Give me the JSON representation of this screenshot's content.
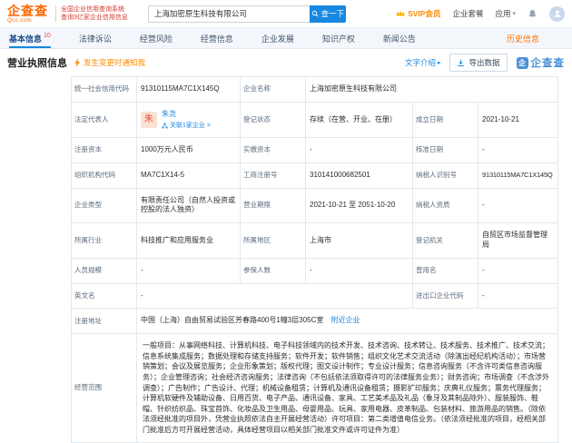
{
  "topbar": {
    "logo": "企查查",
    "logo_domain": "Qcc.com",
    "slogan1": "全国企业信用查询系统",
    "slogan2": "查询3亿家企业信用信息",
    "search_value": "上海加密原生科技有限公司",
    "search_btn": "查一下",
    "svip": "SVIP会员",
    "package": "企业套餐",
    "apps": "应用"
  },
  "nav": {
    "tabs": [
      {
        "label": "基本信息",
        "count": "10"
      },
      {
        "label": "法律诉讼"
      },
      {
        "label": "经营风险"
      },
      {
        "label": "经营信息"
      },
      {
        "label": "企业发展"
      },
      {
        "label": "知识产权"
      },
      {
        "label": "新闻公告"
      },
      {
        "label": "历史信息"
      }
    ]
  },
  "section": {
    "title": "营业执照信息",
    "notify": "发生变更时通知我",
    "text_intro": "文字介绍",
    "export_btn": "导出数据",
    "watermark_badge": "企",
    "watermark": "企查查"
  },
  "license": {
    "labels": {
      "credit_code": "统一社会信用代码",
      "company_name": "企业名称",
      "legal_rep": "法定代表人",
      "reg_status": "登记状态",
      "est_date": "成立日期",
      "reg_capital": "注册资本",
      "paid_capital": "实缴资本",
      "approval_date": "核准日期",
      "org_code": "组织机构代码",
      "reg_no": "工商注册号",
      "taxpayer_no": "纳税人识别号",
      "company_type": "企业类型",
      "business_term": "营业期限",
      "taxpayer_quality": "纳税人资质",
      "industry": "所属行业",
      "region": "所属地区",
      "authority": "登记机关",
      "staff_size": "人员规模",
      "insured_count": "参保人数",
      "former_name": "曾用名",
      "english_name": "英文名",
      "import_export_code": "进出口企业代码",
      "address": "注册地址",
      "scope": "经营范围"
    },
    "values": {
      "credit_code": "91310115MA7C1X145Q",
      "company_name": "上海加密原生科技有限公司",
      "legal_rep_avatar": "朱",
      "legal_rep_name": "朱尧",
      "legal_rep_related": "关联1家企业 >",
      "reg_status": "存续（在营、开业、在册）",
      "est_date": "2021-10-21",
      "reg_capital": "1000万元人民币",
      "paid_capital": "-",
      "approval_date": "-",
      "org_code": "MA7C1X14-5",
      "reg_no": "310141000682501",
      "taxpayer_no": "91310115MA7C1X145Q",
      "company_type": "有限责任公司（自然人投资或控股的法人独资）",
      "business_term": "2021-10-21 至 2051-10-20",
      "taxpayer_quality": "-",
      "industry": "科技推广和应用服务业",
      "region": "上海市",
      "authority": "自贸区市场监督管理局",
      "staff_size": "-",
      "insured_count": "-",
      "former_name": "-",
      "english_name": "-",
      "import_export_code": "-",
      "address": "中国（上海）自由贸易试验区芳春路400号1幢3层305C室",
      "address_nearby": "附近企业",
      "scope": "一般项目：从事网络科技、计算机科技、电子科技领域内的技术开发、技术咨询、技术转让、技术服务、技术推广、技术交流；信息系统集成服务；数据处理和存储支持服务；软件开发；软件销售；组织文化艺术交流活动（除演出经纪机构活动）；市场营销策划；会议及展览服务；企业形象策划；版权代理；图文设计制作；专业设计服务；信息咨询服务（不含许可类信息咨询服务）；企业管理咨询；社会经济咨询服务；法律咨询（不包括依法须取得许可的法律服务业务）；财务咨询；市场调查（不含涉外调查）；广告制作；广告设计、代理；机械设备租赁；计算机及通讯设备租赁；摄影扩印服务；庆典礼仪服务；票务代理服务；计算机软硬件及辅助设备、日用百货、电子产品、通讯设备、家具、工艺美术品及礼品（象牙及其制品除外）、服装服饰、鞋帽、针织纺织品、珠宝首饰、化妆品及卫生用品、母婴用品、玩具、家用电器、皮革制品、包装材料、旅游用品的销售。（除依法须经批准的项目外，凭营业执照依法自主开展经营活动）许可项目：第二类增值电信业务。（依法须经批准的项目，经相关部门批准后方可开展经营活动，具体经营项目以相关部门批准文件或许可证件为准）"
    }
  }
}
